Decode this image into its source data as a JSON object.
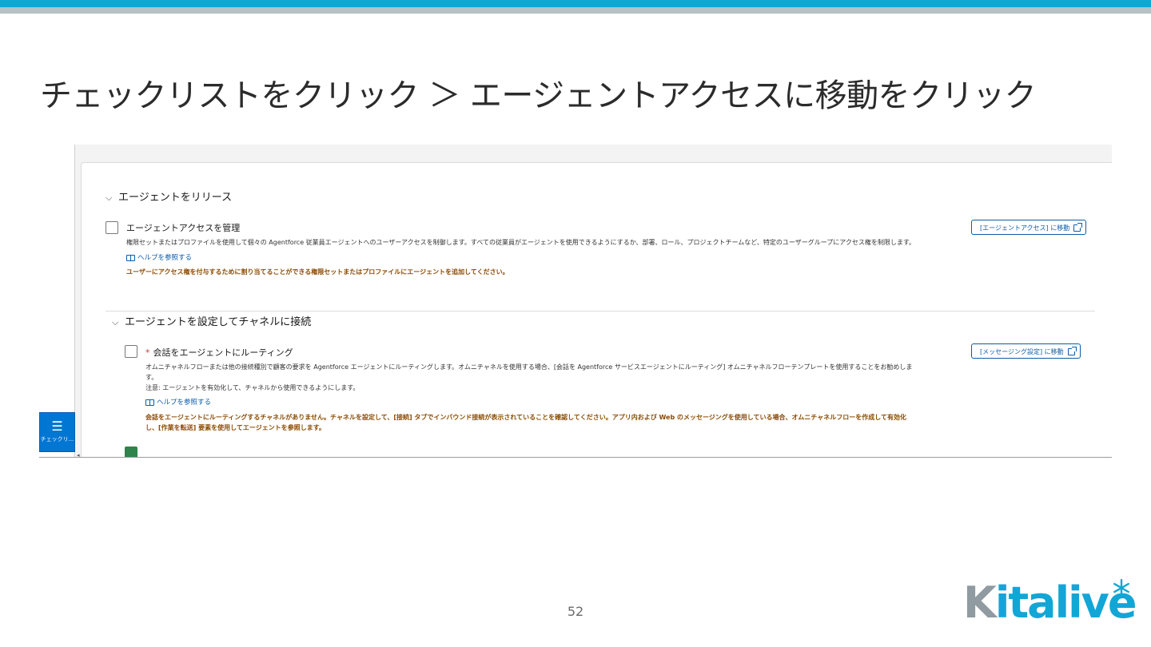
{
  "slide": {
    "title": "チェックリストをクリック ＞ エージェントアクセスに移動をクリック",
    "page_number": "52",
    "logo_text": "Kitalive"
  },
  "screenshot": {
    "section1": {
      "heading": "エージェントをリリース",
      "item": {
        "title": "エージェントアクセスを管理",
        "description": "権限セットまたはプロファイルを使用して個々の Agentforce 従業員エージェントへのユーザーアクセスを制御します。すべての従業員がエージェントを使用できるようにするか、部署、ロール、プロジェクトチームなど、特定のユーザーグループにアクセス権を制限します。",
        "help": "ヘルプを参照する",
        "warning": "ユーザーにアクセス権を付与するために割り当てることができる権限セットまたはプロファイルにエージェントを追加してください。",
        "button": "[エージェントアクセス] に移動"
      }
    },
    "section2": {
      "heading": "エージェントを設定してチャネルに接続",
      "item": {
        "required_mark": "*",
        "title": "会話をエージェントにルーティング",
        "description_1": "オムニチャネルフローまたは他の接続種別で顧客の要求を Agentforce エージェントにルーティングします。オムニチャネルを使用する場合、[会話を Agentforce サービスエージェントにルーティング] オムニチャネルフローテンプレートを使用することをお勧めしま",
        "description_2": "す。",
        "description_3": "注意: エージェントを有効化して、チャネルから使用できるようにします。",
        "help": "ヘルプを参照する",
        "warning_1": "会話をエージェントにルーティングするチャネルがありません。チャネルを設定して、[接続] タブでインバウンド接続が表示されていることを確認してください。アプリ内および Web のメッセージングを使用している場合、オムニチャネルフローを作成して有効化",
        "warning_2": "し、[作業を転送] 要素を使用してエージェントを参照します。",
        "button": "[メッセージング設定] に移動"
      }
    },
    "dock": {
      "icon": "checklist-icon",
      "label": "チェックリ..."
    }
  },
  "colors": {
    "brand_blue": "#12a6d6",
    "brand_gray": "#8f9aa1",
    "link_blue": "#0b5cab",
    "warning": "#8c4b02",
    "dock_blue": "#0176d3"
  }
}
